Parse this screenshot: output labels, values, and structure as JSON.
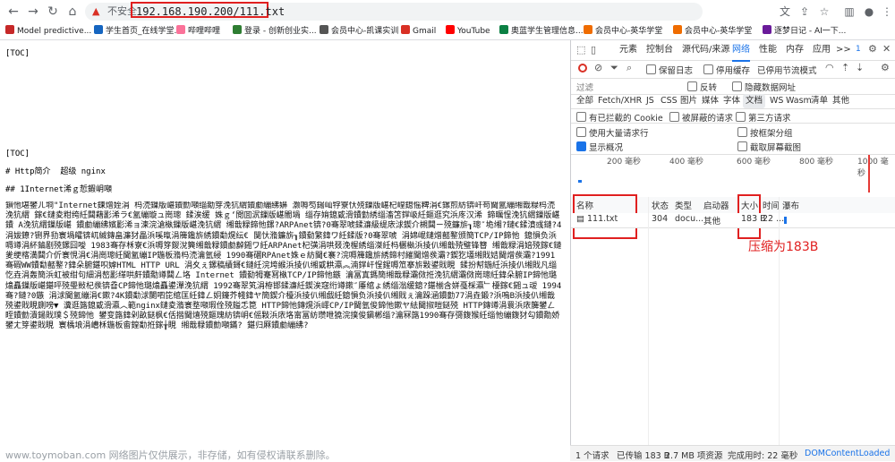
{
  "browser": {
    "insecure_label": "不安全",
    "url": "192.168.190.200/111.txt",
    "bookmarks": [
      {
        "label": "Model predictive...",
        "color": "#c62828"
      },
      {
        "label": "学生首页_在线学堂...",
        "color": "#1565c0"
      },
      {
        "label": "哔哩哔哩",
        "color": "#fb7299"
      },
      {
        "label": "登录 - 创新创业实...",
        "color": "#2e7d32"
      },
      {
        "label": "会员中心-凯课实训",
        "color": "#555555"
      },
      {
        "label": "Gmail",
        "color": "#d93025"
      },
      {
        "label": "YouTube",
        "color": "#ff0000"
      },
      {
        "label": "奥蓝学生管理信息...",
        "color": "#0b8043"
      },
      {
        "label": "会员中心-英华学堂",
        "color": "#ef6c00"
      },
      {
        "label": "会员中心-英华学堂",
        "color": "#ef6c00"
      },
      {
        "label": "逐梦日记 - AI一下...",
        "color": "#6a1b9a"
      }
    ]
  },
  "page": {
    "lines": [
      "[TOC]",
      "[TOC]",
      "# Http简介  超级 nginx",
      "## 1Internet浠ｇ悊鍜岄噸"
    ],
    "garbled": "鎻忚堪鐢ㄦ埛\"Internet鍊熷姪涓  杩涜鏁版嵁鐨勯噸缁勪笌浼犺緭鐨勮繃绋嬶  灏嗕笉鍚屾牸寮忕殑鏁版嵁杞崲鎴愮粺涓€鏍煎紡锛屽苟閫氳繃缃戠粶杩涜浼犺緭 鎵€鏈夌粓绔紝閮藉彲浠ラ€氳繃璇ュ崗璁 鍒涘缓  姝ｇ‘閲囬泦鏁版嵁閽堝 缁存姢鎴戜滑鐨勭綉缁滀笘鐣岋紝鏂逛究浜庝汉浠 鍗曞悜浼犺緭鏁版嵁鐨 A浼犺緭鏁版嵁 鐨勮繃绋嬪彲浠ョ湅浣滄槸鏁版嵁浼犺緭 缃戠粶鍗忚鏍?ARPAnet锛?0骞翠唬鍒濓級缇庡浗鍥介槻閮ㄧ殑鐮旂┒璁″垝缃?鏈€鍒濆彧鏈?4涓妭鐐?铏界劧寰堝皬锛屼絾鏄畠濂犲畾浜嗘暣涓簰鑱旂綉鐨勫熀纭€ 闅忕潃鐮旂┒鐨勬繁鍏ワ紝鍒版?0骞翠唬 涓婂崐鏈熷嚭鐜颁簡TCP/IP鍗忚 鎴愪负浜嗕竴涓紑鏀剧殑鏍囧噯 1983骞存柇寮€浜嗕笌鍐涗簨缃戠粶鐨勮繛鎺ワ紝ARPAnet杞彉涓哄叕浼楃綉缁滐紝杩欐槸浜掕仈缃戠殑璧锋簮 缃戠粶涓婄殑鎵€鏈夎绠楁満閮介伒寰悓涓€涓崗璁紝閫氳繃IP鍦板潃杩涜瀹氫綅 1990骞碅RPAnet姝ｅ紡閫€褰?浣嗕簰鑱旂綉鍗村繀閫熷彂灞?鍥犵壒缃戝姞閫熷彂灞?1991骞碬WW鐨勫嚭鐜?鍏朵腑鍖呮嫭HTML HTTP URL 涓夊ぇ鏍稿績鎶€鏈紝浣垮緱浜掕仈缃戜粠瀛︽湳鐣屽悜鍟嗕笟搴旂敤鍙戝睍 鍒扮幇鍦紝浜掕仈缃戝凡缁忔垚涓轰簡浜虹被绀句細涓嶅彲缂哄皯鐨勪竴閮ㄥ垎 Internet 鐨勬牳蹇冩槸TCP/IP鍗忚鏃 瀹冨寘鎷簡缃戠粶灞傚拰浼犺緭灞傚崗璁紝鍏朵腑IP鍗忚璐熻矗鏁版嵁鍖呯殑璺敱杞彂锛孴CP鍗忚璐熻矗鍙潬浼犺緭 1992骞翠笂涓栫邯鍒濓紝鍥涘窛绗竴鏉″厜绾ょ綉缁滃缓鎴?鍖椾含姘戞棌瀛﹂櫌鎵€鎺ュ叆 1994骞?鏈?0鏃 涓浗閫氳繃涓€鏉?4K鐨勫浗闄呬笓绾匡紝鍏ㄥ姛鑳芥帴鍏ヤ簡鍥介檯浜掕仈缃戯紝鎴愪负浜掕仈缃戝ぇ瀹跺涵鐨勭77涓垚鍛?浜嗚В浜掕仈缃戠殑鍙戝睍鍘嗙▼ 瀵逛簬鎴戜滑瀛︿範nginx鏈夌潃寰堥噸瑕佺殑鎰忎箟 HTTP鍗忚鏄熀浜嶵CP/IP閫氫俊鍗忚鏉ヤ紶閫掓暟鎹殑 HTTP鏄竴涓睘浜庡簲鐢ㄥ眰鐨勯潰鍚戝璞＄殑鍗忚 鐢变簬鍏剁畝鎹枫€佸揩閫熺殑鏂瑰紡锛岄€傜敤浜庡垎甯冨紡瓒呭獟浣撲俊鎭郴缁?瀹冧簬1990骞存彁鍑猴紝缁忚繃鍑犲勾鐨勪娇鐢ㄤ笌鍙戝睍 寰楀埌涓嶆柇鍦板畬鍠勫拰鎵╁睍 缃戠粶鐨勯噸鏋? 鍖归厤鐨勮繃绋?",
    "watermark": "www.toymoban.com 网络图片仅供展示，非存储，如有侵权请联系删除。"
  },
  "devtools": {
    "tabs": [
      "元素",
      "控制台",
      "源代码/来源",
      "网络",
      "性能",
      "内存",
      "应用",
      ">>"
    ],
    "active_tab": "网络",
    "issue_count": "1",
    "toolbar": {
      "preserve_log": "保留日志",
      "disable_cache": "停用缓存",
      "throttle": "已停用节流模式"
    },
    "filter": {
      "placeholder": "过滤",
      "invert": "反转",
      "hide_data_urls": "隐藏数据网址"
    },
    "types": [
      "全部",
      "Fetch/XHR",
      "JS",
      "CSS",
      "图片",
      "媒体",
      "字体",
      "文档",
      "WS",
      "Wasm",
      "清单",
      "其他"
    ],
    "active_type": "文档",
    "options": {
      "blocked_cookies": "有已拦截的 Cookie",
      "blocked_requests": "被屏蔽的请求",
      "third_party": "第三方请求",
      "big_rows": "使用大量请求行",
      "group_by_frame": "按框架分组",
      "overview": "显示概况",
      "screenshots": "截取屏幕截图"
    },
    "timeline_ticks": [
      "200 毫秒",
      "400 毫秒",
      "600 毫秒",
      "800 毫秒",
      "1000 毫秒"
    ],
    "columns": [
      "名称",
      "状态",
      "类型",
      "启动器",
      "大小",
      "时间",
      "瀑布"
    ],
    "row": {
      "name": "111.txt",
      "status": "304",
      "type": "docu...",
      "initiator": "其他",
      "size": "183 B",
      "time": "22 ..."
    },
    "annotation": "压缩为183B",
    "status_bar": {
      "requests": "1 个请求",
      "transferred": "已传输 183 B",
      "resources": "2.7 MB 项资源",
      "finish": "完成用时: 22 毫秒",
      "dom": "DOMContentLoaded"
    },
    "colors": {
      "accent": "#1a73e8",
      "annotation": "#e02020",
      "record": "#d93025"
    }
  }
}
